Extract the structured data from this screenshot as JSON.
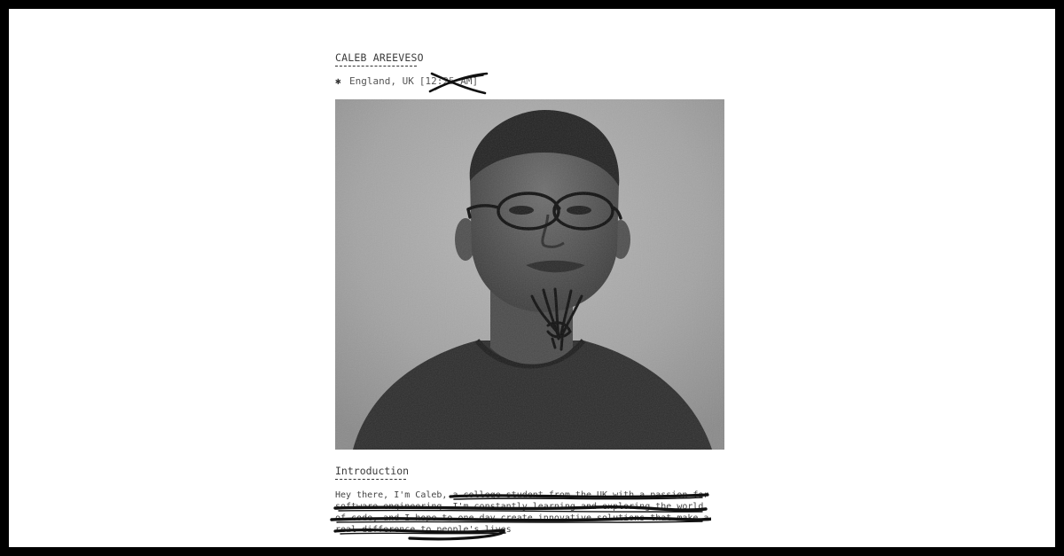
{
  "profile": {
    "name": "CALEB AREEVESO",
    "location_icon": "asterisk-icon",
    "asterisk": "✱",
    "location": "England, UK",
    "time_open": "[12:",
    "time_hidden": "25",
    "time_close": "AM]"
  },
  "photo": {
    "description_icon": "portrait-photo"
  },
  "intro": {
    "title": "Introduction",
    "text": "Hey there, I'm Caleb, a college student from the UK with a passion for\nsoftware engineering. I'm constantly learning and exploring the world\nof code, and I hope to one day create innovative solutions that make a\nreal difference to people's lives"
  },
  "colors": {
    "background": "#ffffff",
    "frame": "#000000",
    "text": "#3a3a3a",
    "ink": "#111111"
  }
}
